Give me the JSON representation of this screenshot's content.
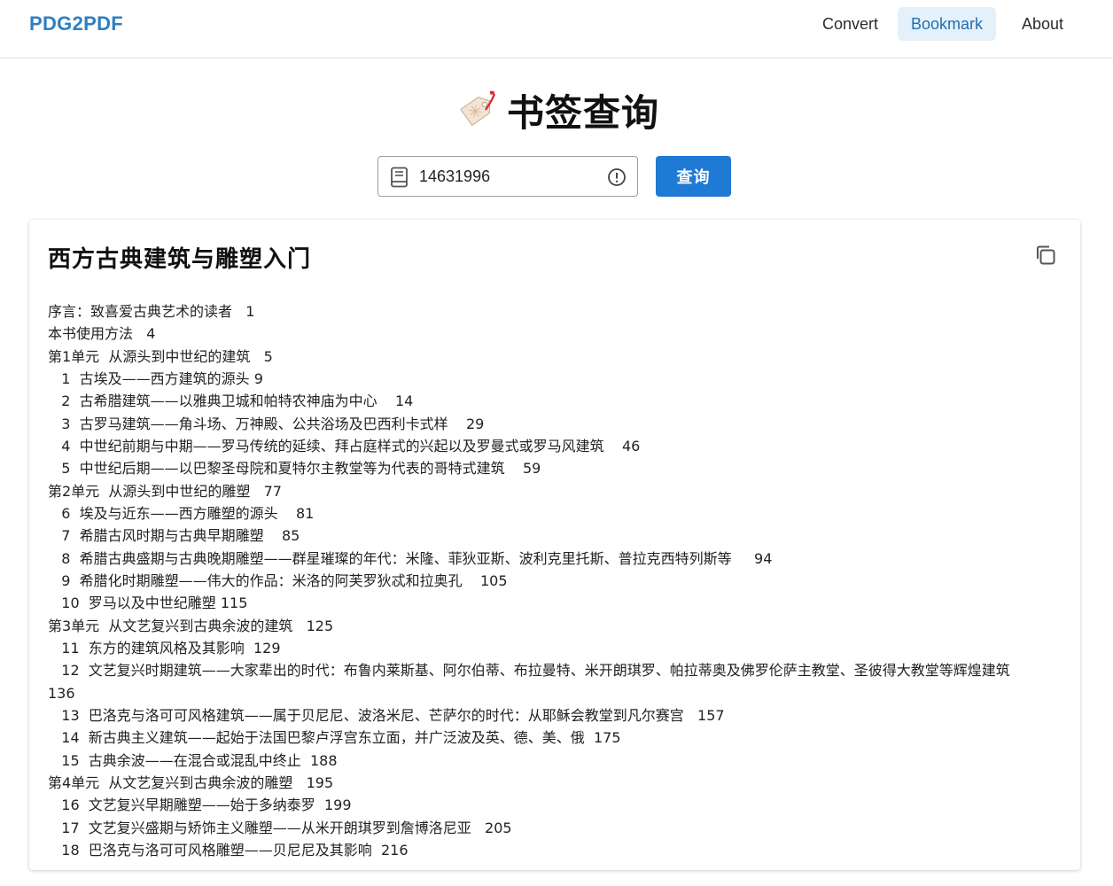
{
  "app": {
    "brand": "PDG2PDF",
    "nav": [
      {
        "label": "Convert",
        "active": false
      },
      {
        "label": "Bookmark",
        "active": true
      },
      {
        "label": "About",
        "active": false
      }
    ],
    "accent_color": "#1f7ad6"
  },
  "page": {
    "heading": "书签查询",
    "heading_icon": "bookmark-tag-icon"
  },
  "search": {
    "value": "14631996",
    "leading_icon": "book-icon",
    "trailing_icon": "alert-circle-icon",
    "button_label": "查询"
  },
  "result": {
    "title": "西方古典建筑与雕塑入门",
    "copy_icon": "copy-icon",
    "toc": [
      "序言：致喜爱古典艺术的读者   1",
      "本书使用方法   4",
      "第1单元  从源头到中世纪的建筑   5",
      "   1  古埃及——西方建筑的源头 9",
      "   2  古希腊建筑——以雅典卫城和帕特农神庙为中心    14",
      "   3  古罗马建筑——角斗场、万神殿、公共浴场及巴西利卡式样    29",
      "   4  中世纪前期与中期——罗马传统的延续、拜占庭样式的兴起以及罗曼式或罗马风建筑    46",
      "   5  中世纪后期——以巴黎圣母院和夏特尔主教堂等为代表的哥特式建筑    59",
      "第2单元  从源头到中世纪的雕塑   77",
      "   6  埃及与近东——西方雕塑的源头    81",
      "   7  希腊古风时期与古典早期雕塑    85",
      "   8  希腊古典盛期与古典晚期雕塑——群星璀璨的年代：米隆、菲狄亚斯、波利克里托斯、普拉克西特列斯等     94",
      "   9  希腊化时期雕塑——伟大的作品：米洛的阿芙罗狄忒和拉奥孔    105",
      "   10  罗马以及中世纪雕塑 115",
      "第3单元  从文艺复兴到古典余波的建筑   125",
      "   11  东方的建筑风格及其影响  129",
      "   12  文艺复兴时期建筑——大家辈出的时代：布鲁内莱斯基、阿尔伯蒂、布拉曼特、米开朗琪罗、帕拉蒂奥及佛罗伦萨主教堂、圣彼得大教堂等辉煌建筑    136",
      "   13  巴洛克与洛可可风格建筑——属于贝尼尼、波洛米尼、芒萨尔的时代：从耶稣会教堂到凡尔赛宫   157",
      "   14  新古典主义建筑——起始于法国巴黎卢浮宫东立面，并广泛波及英、德、美、俄  175",
      "   15  古典余波——在混合或混乱中终止  188",
      "第4单元  从文艺复兴到古典余波的雕塑   195",
      "   16  文艺复兴早期雕塑——始于多纳泰罗  199",
      "   17  文艺复兴盛期与矫饰主义雕塑——从米开朗琪罗到詹博洛尼亚   205",
      "   18  巴洛克与洛可可风格雕塑——贝尼尼及其影响  216"
    ]
  }
}
